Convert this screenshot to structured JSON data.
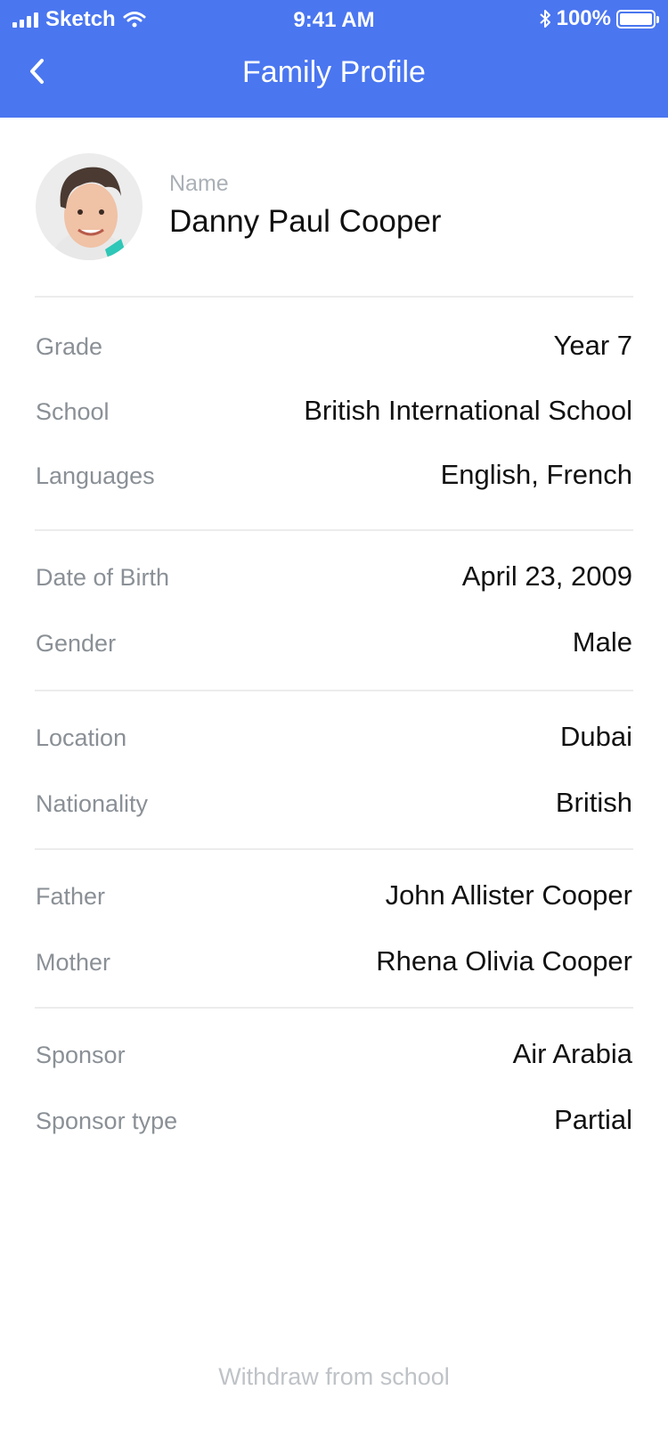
{
  "status_bar": {
    "carrier": "Sketch",
    "time": "9:41 AM",
    "battery": "100%",
    "battery_level": 1.0
  },
  "nav": {
    "title": "Family Profile",
    "back_icon": "chevron-left-icon"
  },
  "profile": {
    "name_label": "Name",
    "name_value": "Danny Paul Cooper"
  },
  "sections": [
    [
      {
        "label": "Grade",
        "value": "Year 7"
      },
      {
        "label": "School",
        "value": "British International School"
      },
      {
        "label": "Languages",
        "value": "English, French"
      }
    ],
    [
      {
        "label": "Date of Birth",
        "value": "April 23, 2009"
      },
      {
        "label": "Gender",
        "value": "Male"
      }
    ],
    [
      {
        "label": "Location",
        "value": "Dubai"
      },
      {
        "label": "Nationality",
        "value": "British"
      }
    ],
    [
      {
        "label": "Father",
        "value": "John Allister Cooper"
      },
      {
        "label": "Mother",
        "value": "Rhena Olivia Cooper"
      }
    ],
    [
      {
        "label": "Sponsor",
        "value": "Air Arabia"
      },
      {
        "label": "Sponsor type",
        "value": "Partial"
      }
    ]
  ],
  "footer": {
    "withdraw_label": "Withdraw from school"
  },
  "colors": {
    "header": "#4a76f0",
    "label": "#8a9096",
    "value": "#111111",
    "divider": "#ececec",
    "withdraw": "#bfc3c7"
  }
}
